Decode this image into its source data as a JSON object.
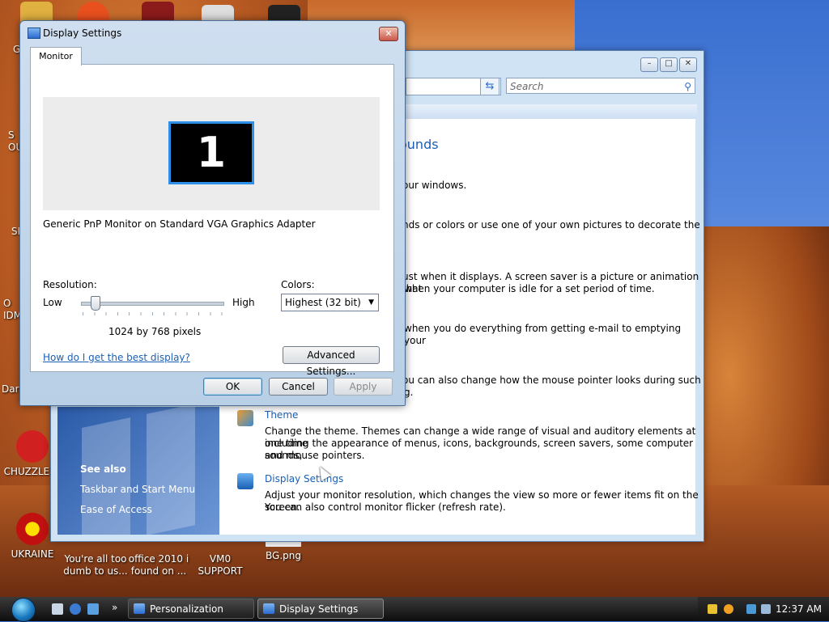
{
  "desktop": {
    "icons": [
      {
        "label": "UKRAINE"
      },
      {
        "label": "You're all too dumb to us..."
      },
      {
        "label": "office 2010 i found on ..."
      },
      {
        "label": "VM0 SUPPORT"
      },
      {
        "label": "BG.png"
      },
      {
        "label": "CHUZZLE M"
      }
    ],
    "clipped_labels": [
      "G",
      "S OU",
      "SP",
      "O IDM",
      "Dark"
    ]
  },
  "personalization_window": {
    "search_placeholder": "Search",
    "heading": "ounds",
    "lines": [
      "our windows.",
      "nds or colors or use one of your own pictures to decorate the",
      "ust when it displays. A screen saver is a picture or animation that",
      "when your computer is idle for a set period of time.",
      "when you do everything from getting e-mail to emptying your",
      "ou can also change how the mouse pointer looks during such",
      "g."
    ],
    "theme_link": "Theme",
    "theme_desc_1": "Change the theme. Themes can change a wide range of visual and auditory elements at one time",
    "theme_desc_2": "including the appearance of menus, icons, backgrounds, screen savers, some computer sounds,",
    "theme_desc_3": "and mouse pointers.",
    "display_link": "Display Settings",
    "display_desc_1": "Adjust your monitor resolution, which changes the view so more or fewer items fit on the screen.",
    "display_desc_2": "You can also control monitor flicker (refresh rate).",
    "see_also": "See also",
    "see_also_links": [
      "Taskbar and Start Menu",
      "Ease of Access"
    ]
  },
  "dialog": {
    "title": "Display Settings",
    "tab": "Monitor",
    "monitor_number": "1",
    "monitor_desc": "Generic PnP Monitor on Standard VGA Graphics Adapter",
    "resolution_label": "Resolution:",
    "low": "Low",
    "high": "High",
    "resolution_value": "1024 by 768 pixels",
    "colors_label": "Colors:",
    "colors_value": "Highest (32 bit)",
    "help_link": "How do I get the best display?",
    "advanced_button": "Advanced Settings...",
    "ok": "OK",
    "cancel": "Cancel",
    "apply": "Apply"
  },
  "taskbar": {
    "tasks": [
      "Personalization",
      "Display Settings"
    ],
    "clock": "12:37 AM"
  }
}
